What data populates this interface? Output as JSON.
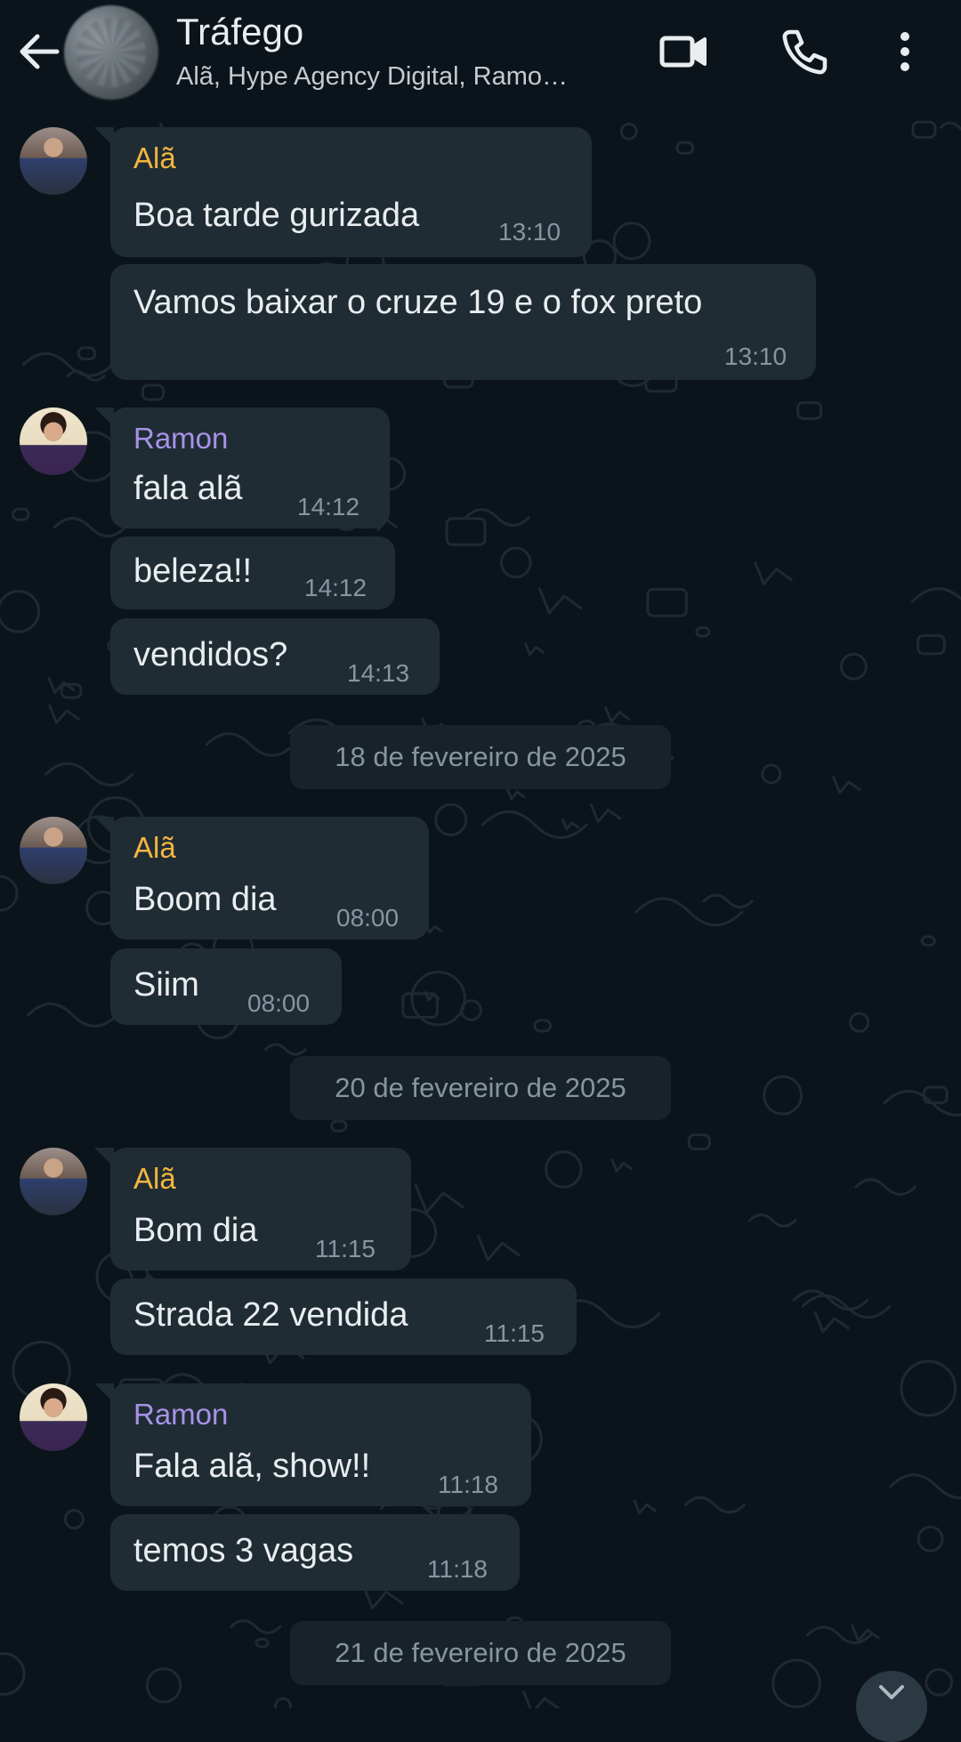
{
  "header": {
    "title": "Tráfego",
    "subtitle": "Alã, Hype Agency Digital, Ramo…"
  },
  "icons": {
    "back": "arrow-back-icon",
    "video": "video-call-icon",
    "call": "phone-icon",
    "menu": "more-vertical-icon",
    "scroll": "chevron-down-icon"
  },
  "colors": {
    "background": "#0b141a",
    "bubble": "#202c33",
    "sender_ala": "#f4b63f",
    "sender_ramon": "#a792e8",
    "timestamp": "#8696a0"
  },
  "messages": [
    {
      "sender": "Alã",
      "text": "Boa tarde gurizada",
      "time": "13:10"
    },
    {
      "text": "Vamos baixar o cruze 19 e o fox preto",
      "time": "13:10"
    },
    {
      "sender": "Ramon",
      "text": "fala alã",
      "time": "14:12"
    },
    {
      "text": "beleza!!",
      "time": "14:12"
    },
    {
      "text": "vendidos?",
      "time": "14:13"
    },
    {
      "date": "18 de fevereiro de 2025"
    },
    {
      "sender": "Alã",
      "text": "Boom dia",
      "time": "08:00"
    },
    {
      "text": "Siim",
      "time": "08:00"
    },
    {
      "date": "20 de fevereiro de 2025"
    },
    {
      "sender": "Alã",
      "text": "Bom dia",
      "time": "11:15"
    },
    {
      "text": "Strada 22 vendida",
      "time": "11:15"
    },
    {
      "sender": "Ramon",
      "text": "Fala alã, show!!",
      "time": "11:18"
    },
    {
      "text": "temos 3 vagas",
      "time": "11:18"
    },
    {
      "date": "21 de fevereiro de 2025"
    }
  ]
}
